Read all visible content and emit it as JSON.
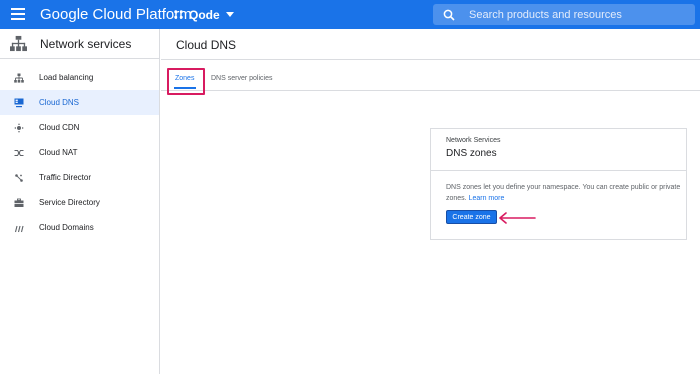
{
  "topbar": {
    "brand": "Google Cloud Platform",
    "project": "Qode",
    "search_placeholder": "Search products and resources",
    "color": "#1a73e8"
  },
  "sidebar": {
    "title": "Network services",
    "items": [
      {
        "label": "Load balancing",
        "icon": "load-balancing-icon",
        "active": false
      },
      {
        "label": "Cloud DNS",
        "icon": "cloud-dns-icon",
        "active": true
      },
      {
        "label": "Cloud CDN",
        "icon": "cloud-cdn-icon",
        "active": false
      },
      {
        "label": "Cloud NAT",
        "icon": "cloud-nat-icon",
        "active": false
      },
      {
        "label": "Traffic Director",
        "icon": "traffic-director-icon",
        "active": false
      },
      {
        "label": "Service Directory",
        "icon": "service-directory-icon",
        "active": false
      },
      {
        "label": "Cloud Domains",
        "icon": "cloud-domains-icon",
        "active": false
      }
    ]
  },
  "main": {
    "title": "Cloud DNS",
    "tabs": [
      {
        "label": "Zones",
        "active": true
      },
      {
        "label": "DNS server policies",
        "active": false
      }
    ]
  },
  "card": {
    "eyebrow": "Network Services",
    "title": "DNS zones",
    "description": "DNS zones let you define your namespace. You can create public or private zones.",
    "learn_more": "Learn more",
    "button": "Create zone"
  },
  "annotation_color": "#d81b60"
}
